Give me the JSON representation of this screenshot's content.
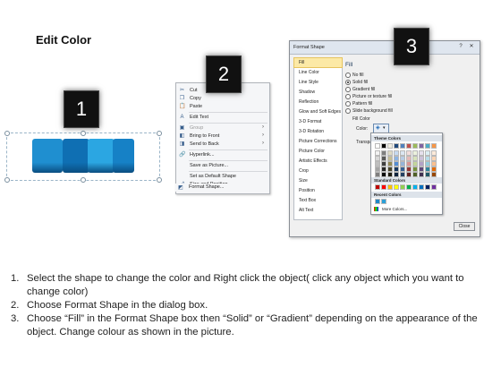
{
  "title": "Edit Color",
  "steps": {
    "one": "1",
    "two": "2",
    "three": "3"
  },
  "context_menu": {
    "items": [
      {
        "icon": "scissors-icon",
        "glyph": "✂",
        "label": "Cut",
        "arrow": ""
      },
      {
        "icon": "copy-icon",
        "glyph": "❐",
        "label": "Copy",
        "arrow": ""
      },
      {
        "icon": "paste-icon",
        "glyph": "📋",
        "label": "Paste",
        "arrow": ""
      },
      {
        "icon": "edit-text-icon",
        "glyph": "A",
        "label": "Edit Text",
        "arrow": ""
      },
      {
        "icon": "group-icon",
        "glyph": "▣",
        "label": "Group",
        "arrow": "›"
      },
      {
        "icon": "bring-front-icon",
        "glyph": "◧",
        "label": "Bring to Front",
        "arrow": "›"
      },
      {
        "icon": "send-back-icon",
        "glyph": "◨",
        "label": "Send to Back",
        "arrow": "›"
      },
      {
        "icon": "hyperlink-icon",
        "glyph": "🔗",
        "label": "Hyperlink...",
        "arrow": ""
      },
      {
        "icon": "",
        "glyph": "",
        "label": "Save as Picture...",
        "arrow": ""
      },
      {
        "icon": "",
        "glyph": "",
        "label": "Set as Default Shape",
        "arrow": ""
      },
      {
        "icon": "size-position-icon",
        "glyph": "⤢",
        "label": "Size and Position...",
        "arrow": ""
      },
      {
        "icon": "format-shape-icon",
        "glyph": "◩",
        "label": "Format Shape...",
        "arrow": ""
      }
    ]
  },
  "dialog": {
    "title": "Format Shape",
    "nav": [
      "Fill",
      "Line Color",
      "Line Style",
      "Shadow",
      "Reflection",
      "Glow and Soft Edges",
      "3-D Format",
      "3-D Rotation",
      "Picture Corrections",
      "Picture Color",
      "Artistic Effects",
      "Crop",
      "Size",
      "Position",
      "Text Box",
      "Alt Text"
    ],
    "fill_heading": "Fill",
    "options": [
      "No fill",
      "Solid fill",
      "Gradient fill",
      "Picture or texture fill",
      "Pattern fill",
      "Slide background fill"
    ],
    "fill_color_label": "Fill Color",
    "color_label": "Color:",
    "transparency_label": "Transpa",
    "close_label": "Close"
  },
  "color_popup": {
    "theme_label": "Theme Colors",
    "standard_label": "Standard Colors",
    "recent_label": "Recent Colors",
    "more_label": "More Colors...",
    "theme_top": [
      "#ffffff",
      "#000000",
      "#eeece1",
      "#1f497d",
      "#4f81bd",
      "#c0504d",
      "#9bbb59",
      "#8064a2",
      "#4bacc6",
      "#f79646"
    ],
    "theme_shades": [
      [
        "#f2f2f2",
        "#7f7f7f",
        "#ddd9c3",
        "#c6d9f0",
        "#dbe5f1",
        "#f2dcdb",
        "#ebf1dd",
        "#e5e0ec",
        "#dbeef3",
        "#fdeada"
      ],
      [
        "#d8d8d8",
        "#595959",
        "#c4bd97",
        "#8db3e2",
        "#b8cce4",
        "#e5b9b7",
        "#d7e3bc",
        "#ccc1d9",
        "#b7dde8",
        "#fbd5b5"
      ],
      [
        "#bfbfbf",
        "#3f3f3f",
        "#938953",
        "#548dd4",
        "#95b3d7",
        "#d99694",
        "#c3d69b",
        "#b2a2c7",
        "#92cddc",
        "#fac08f"
      ],
      [
        "#a5a5a5",
        "#262626",
        "#494429",
        "#17365d",
        "#366092",
        "#953734",
        "#76923c",
        "#5f497a",
        "#31859b",
        "#e36c09"
      ],
      [
        "#7f7f7f",
        "#0c0c0c",
        "#1d1b10",
        "#0f243e",
        "#244061",
        "#632423",
        "#4f6128",
        "#3f3151",
        "#205867",
        "#974806"
      ]
    ],
    "standard": [
      "#c00000",
      "#ff0000",
      "#ffc000",
      "#ffff00",
      "#92d050",
      "#00b050",
      "#00b0f0",
      "#0070c0",
      "#002060",
      "#7030a0"
    ],
    "recent": [
      "#1e88c8",
      "#2aa0d8"
    ]
  },
  "puzzle_colors": [
    "#1f8fd0",
    "#0f6fb3",
    "#2ba6e2",
    "#1681c6"
  ],
  "instructions": [
    {
      "num": "1.",
      "text": "Select the shape to change the color and Right click the object( click any object which you want to change color)"
    },
    {
      "num": "2.",
      "text": "Choose Format Shape in the dialog box."
    },
    {
      "num": "3.",
      "text": "Choose “Fill” in the Format Shape box then “Solid” or “Gradient” depending on the appearance of the object. Change colour as shown in the picture."
    }
  ]
}
